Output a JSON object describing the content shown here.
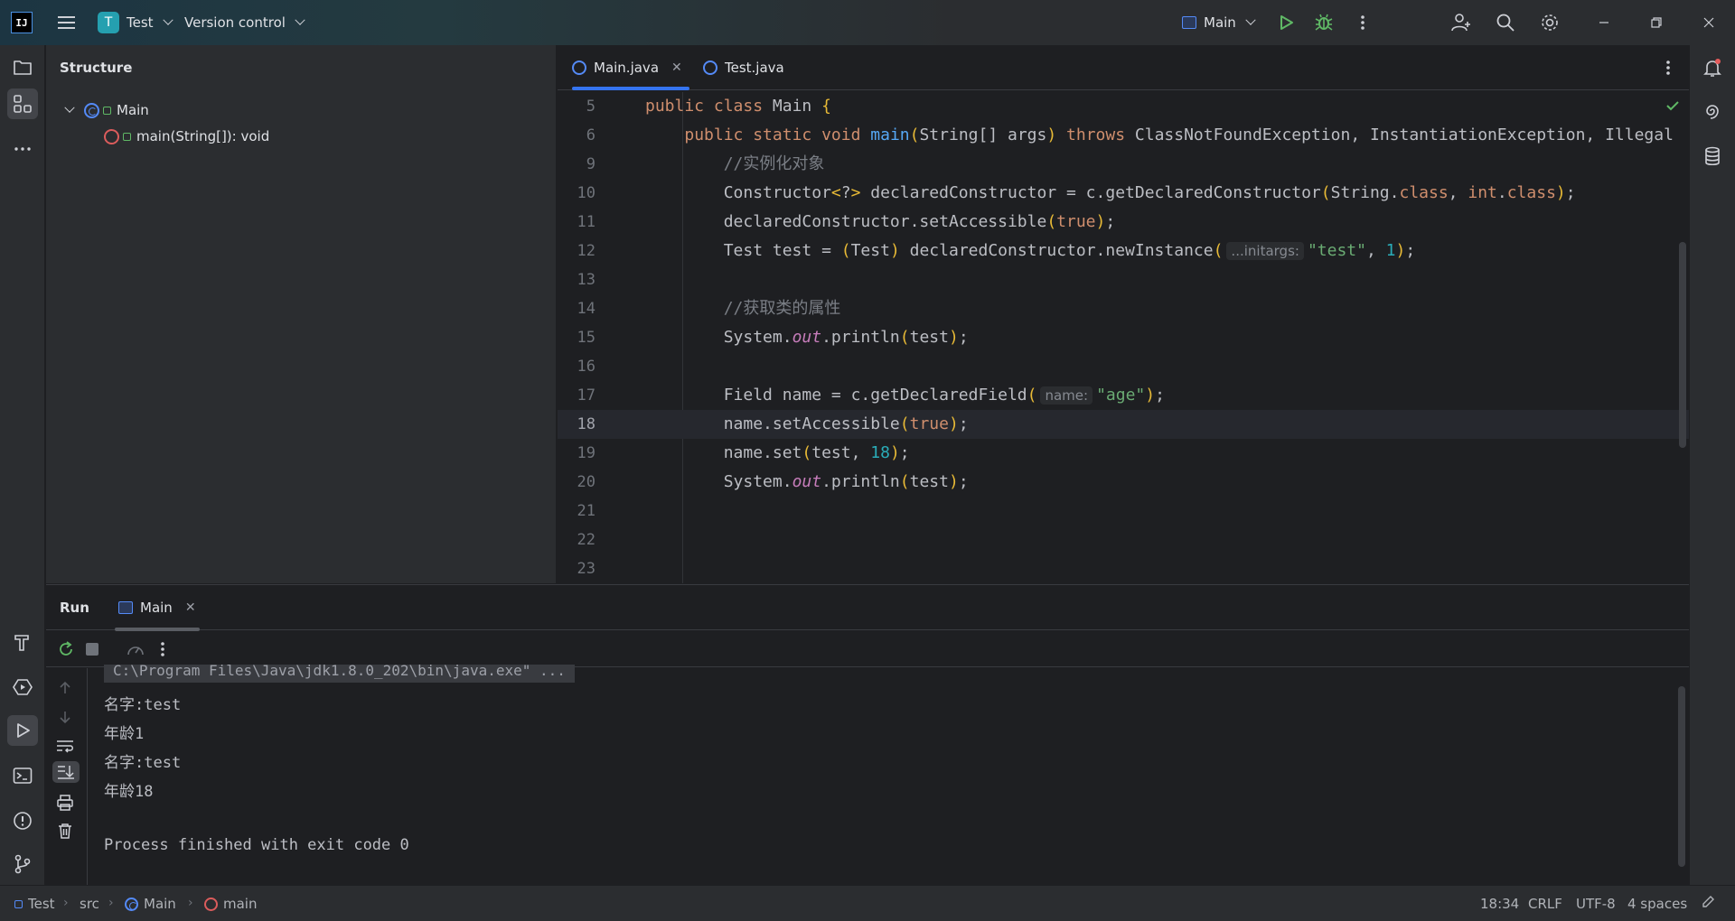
{
  "titlebar": {
    "logo": "IJ",
    "project_initial": "T",
    "project_name": "Test",
    "vcs_label": "Version control",
    "run_config": "Main"
  },
  "structure": {
    "title": "Structure",
    "class_name": "Main",
    "method_name": "main(String[]): void"
  },
  "editor": {
    "tabs": [
      {
        "label": "Main.java",
        "active": true
      },
      {
        "label": "Test.java",
        "active": false
      }
    ],
    "lines": [
      {
        "num": "5",
        "tokens": [
          [
            "kw",
            "public class "
          ],
          [
            "",
            "Main "
          ],
          [
            "br1",
            "{"
          ]
        ]
      },
      {
        "num": "6",
        "tokens": [
          [
            "",
            "    "
          ],
          [
            "kw",
            "public static void "
          ],
          [
            "fn",
            "main"
          ],
          [
            "br1",
            "("
          ],
          [
            "",
            "String[] args"
          ],
          [
            "br1",
            ")"
          ],
          [
            "kw",
            " throws "
          ],
          [
            "",
            "ClassNotFoundException, InstantiationException, Illegal"
          ]
        ]
      },
      {
        "num": "9",
        "tokens": [
          [
            "",
            "        "
          ],
          [
            "cmt",
            "//实例化对象"
          ]
        ]
      },
      {
        "num": "10",
        "tokens": [
          [
            "",
            "        Constructor"
          ],
          [
            "br1",
            "<"
          ],
          [
            "",
            "?"
          ],
          [
            "br1",
            ">"
          ],
          [
            "",
            " declaredConstructor = c.getDeclaredConstructor"
          ],
          [
            "br1",
            "("
          ],
          [
            "",
            "String."
          ],
          [
            "kw",
            "class"
          ],
          [
            "",
            ", "
          ],
          [
            "kw",
            "int"
          ],
          [
            "",
            "."
          ],
          [
            "kw",
            "class"
          ],
          [
            "br1",
            ")"
          ],
          [
            "",
            ";"
          ]
        ]
      },
      {
        "num": "11",
        "tokens": [
          [
            "",
            "        declaredConstructor.setAccessible"
          ],
          [
            "br1",
            "("
          ],
          [
            "kw",
            "true"
          ],
          [
            "br1",
            ")"
          ],
          [
            "",
            ";"
          ]
        ]
      },
      {
        "num": "12",
        "tokens": [
          [
            "",
            "        Test test = "
          ],
          [
            "br1",
            "("
          ],
          [
            "",
            "Test"
          ],
          [
            "br1",
            ")"
          ],
          [
            "",
            " declaredConstructor.newInstance"
          ],
          [
            "br1",
            "("
          ],
          [
            "hint",
            "...initargs:"
          ],
          [
            "str",
            "\"test\""
          ],
          [
            "",
            ", "
          ],
          [
            "num",
            "1"
          ],
          [
            "br1",
            ")"
          ],
          [
            "",
            ";"
          ]
        ]
      },
      {
        "num": "13",
        "tokens": []
      },
      {
        "num": "14",
        "tokens": [
          [
            "",
            "        "
          ],
          [
            "cmt",
            "//获取类的属性"
          ]
        ]
      },
      {
        "num": "15",
        "tokens": [
          [
            "",
            "        System."
          ],
          [
            "it",
            "out"
          ],
          [
            "",
            ".println"
          ],
          [
            "br1",
            "("
          ],
          [
            "",
            "test"
          ],
          [
            "br1",
            ")"
          ],
          [
            "",
            ";"
          ]
        ]
      },
      {
        "num": "16",
        "tokens": []
      },
      {
        "num": "17",
        "tokens": [
          [
            "",
            "        Field name = c.getDeclaredField"
          ],
          [
            "br1",
            "("
          ],
          [
            "hint",
            "name:"
          ],
          [
            "str",
            "\"age\""
          ],
          [
            "br1",
            ")"
          ],
          [
            "",
            ";"
          ]
        ]
      },
      {
        "num": "18",
        "tokens": [
          [
            "",
            "        name.setAccessible"
          ],
          [
            "br1",
            "("
          ],
          [
            "kw",
            "true"
          ],
          [
            "br1",
            ")"
          ],
          [
            "",
            ";"
          ]
        ],
        "current": true
      },
      {
        "num": "19",
        "tokens": [
          [
            "",
            "        name.set"
          ],
          [
            "br1",
            "("
          ],
          [
            "",
            "test, "
          ],
          [
            "num",
            "18"
          ],
          [
            "br1",
            ")"
          ],
          [
            "",
            ";"
          ]
        ]
      },
      {
        "num": "20",
        "tokens": [
          [
            "",
            "        System."
          ],
          [
            "it",
            "out"
          ],
          [
            "",
            ".println"
          ],
          [
            "br1",
            "("
          ],
          [
            "",
            "test"
          ],
          [
            "br1",
            ")"
          ],
          [
            "",
            ";"
          ]
        ]
      },
      {
        "num": "21",
        "tokens": []
      },
      {
        "num": "22",
        "tokens": []
      },
      {
        "num": "23",
        "tokens": []
      }
    ]
  },
  "run": {
    "title": "Run",
    "tab_label": "Main",
    "command": "C:\\Program Files\\Java\\jdk1.8.0_202\\bin\\java.exe\" ...",
    "output": [
      "名字:test",
      "年龄1",
      "名字:test",
      "年龄18",
      "",
      "Process finished with exit code 0"
    ]
  },
  "statusbar": {
    "breadcrumbs": [
      "Test",
      "src",
      "Main",
      "main"
    ],
    "position": "18:34",
    "line_sep": "CRLF",
    "encoding": "UTF-8",
    "indent": "4 spaces"
  },
  "colors": {
    "accent": "#3574f0",
    "run_green": "#5fb865",
    "debug_green": "#5fb865",
    "keyword": "#cf8e6d",
    "string": "#6aab73",
    "number": "#2aacb8"
  }
}
